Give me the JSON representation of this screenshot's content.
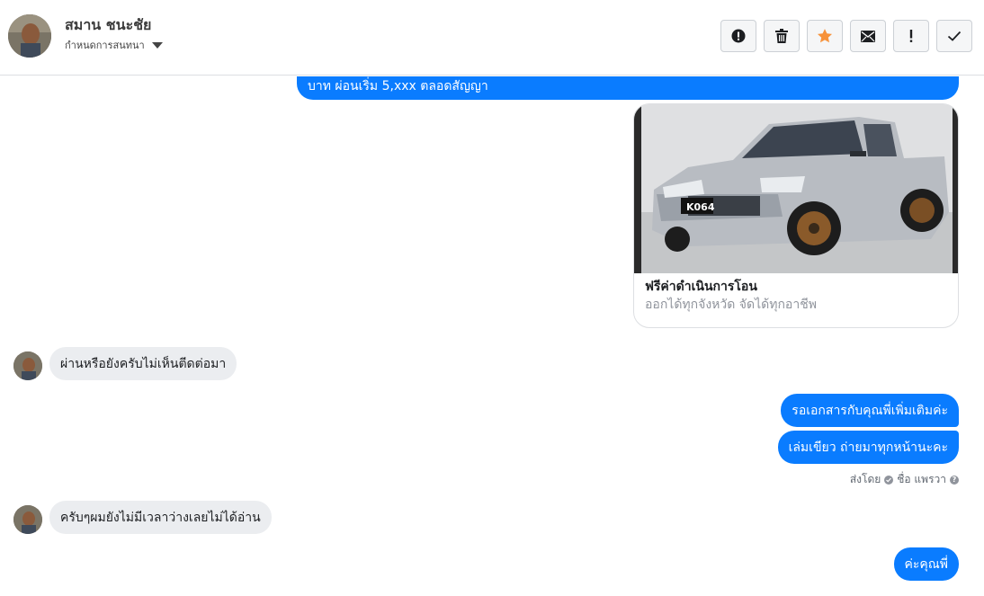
{
  "header": {
    "contact_name": "สมาน ชนะชัย",
    "assign_label": "กำหนดการสนทนา",
    "tools": [
      {
        "icon": "alert-circle-icon"
      },
      {
        "icon": "trash-icon"
      },
      {
        "icon": "star-icon",
        "color": "#f7923a"
      },
      {
        "icon": "envelope-icon"
      },
      {
        "icon": "exclamation-icon"
      },
      {
        "icon": "check-icon"
      }
    ]
  },
  "messages": {
    "m1_text": "บาท ผ่อนเริ่ม 5,xxx ตลอดสัญญา",
    "card": {
      "plate": "K064",
      "title": "ฟรีค่าดำเนินการโอน",
      "subtitle": "ออกได้ทุกจังหวัด จัดได้ทุกอาชีพ"
    },
    "m2_text": "ผ่านหรือยังครับไม่เห็นตีดต่อมา",
    "m3_text": "รอเอกสารกับคุณพี่เพิ่มเติมค่ะ",
    "m4_text": "เล่มเขียว ถ่ายมาทุกหน้านะคะ",
    "sent_by_label": "ส่งโดย",
    "sent_by_name": "ชื่อ แพรวา",
    "m5_text": "ครับๆผมยังไม่มีเวลาว่างเลยไม่ได้อ่าน",
    "m6_text": "ค่ะคุณพี่"
  },
  "colors": {
    "outgoing_bubble": "#0a7cff",
    "incoming_bubble": "#ebedf0",
    "star": "#f7923a"
  }
}
